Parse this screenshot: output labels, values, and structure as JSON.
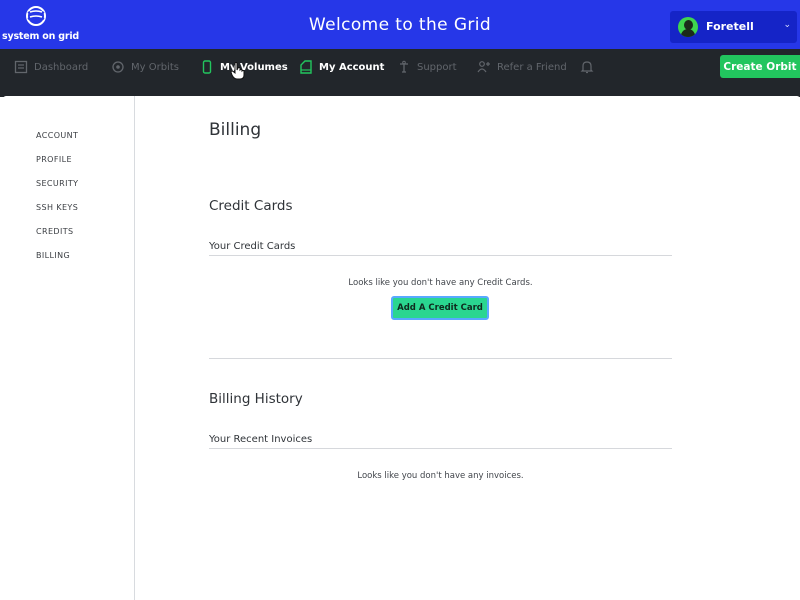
{
  "header": {
    "logo_text": "system on grid",
    "title": "Welcome to the Grid",
    "user_name": "Foretell",
    "user_chevron": "⌄"
  },
  "nav": {
    "items": [
      {
        "label": "Dashboard",
        "icon": "dashboard-icon",
        "active": false
      },
      {
        "label": "My Orbits",
        "icon": "orbit-icon",
        "active": false
      },
      {
        "label": "My Volumes",
        "icon": "volume-icon",
        "active": true
      },
      {
        "label": "My Account",
        "icon": "account-icon",
        "active": true
      },
      {
        "label": "Support",
        "icon": "support-icon",
        "active": false
      },
      {
        "label": "Refer a Friend",
        "icon": "refer-icon",
        "active": false
      }
    ],
    "bell_icon": "bell-icon",
    "create_button": "Create Orbit"
  },
  "sidebar": {
    "items": [
      {
        "label": "ACCOUNT"
      },
      {
        "label": "PROFILE"
      },
      {
        "label": "SECURITY"
      },
      {
        "label": "SSH KEYS"
      },
      {
        "label": "CREDITS"
      },
      {
        "label": "BILLING"
      }
    ]
  },
  "main": {
    "page_title": "Billing",
    "credit_cards": {
      "title": "Credit Cards",
      "subtitle": "Your Credit Cards",
      "empty_message": "Looks like you don't have any Credit Cards.",
      "add_button": "Add A Credit Card"
    },
    "billing_history": {
      "title": "Billing History",
      "subtitle": "Your Recent Invoices",
      "empty_message": "Looks like you don't have any invoices."
    }
  },
  "colors": {
    "header_bg": "#2637e8",
    "nav_bg": "#22262b",
    "accent_green": "#22c55e",
    "button_green": "#2ad690"
  }
}
